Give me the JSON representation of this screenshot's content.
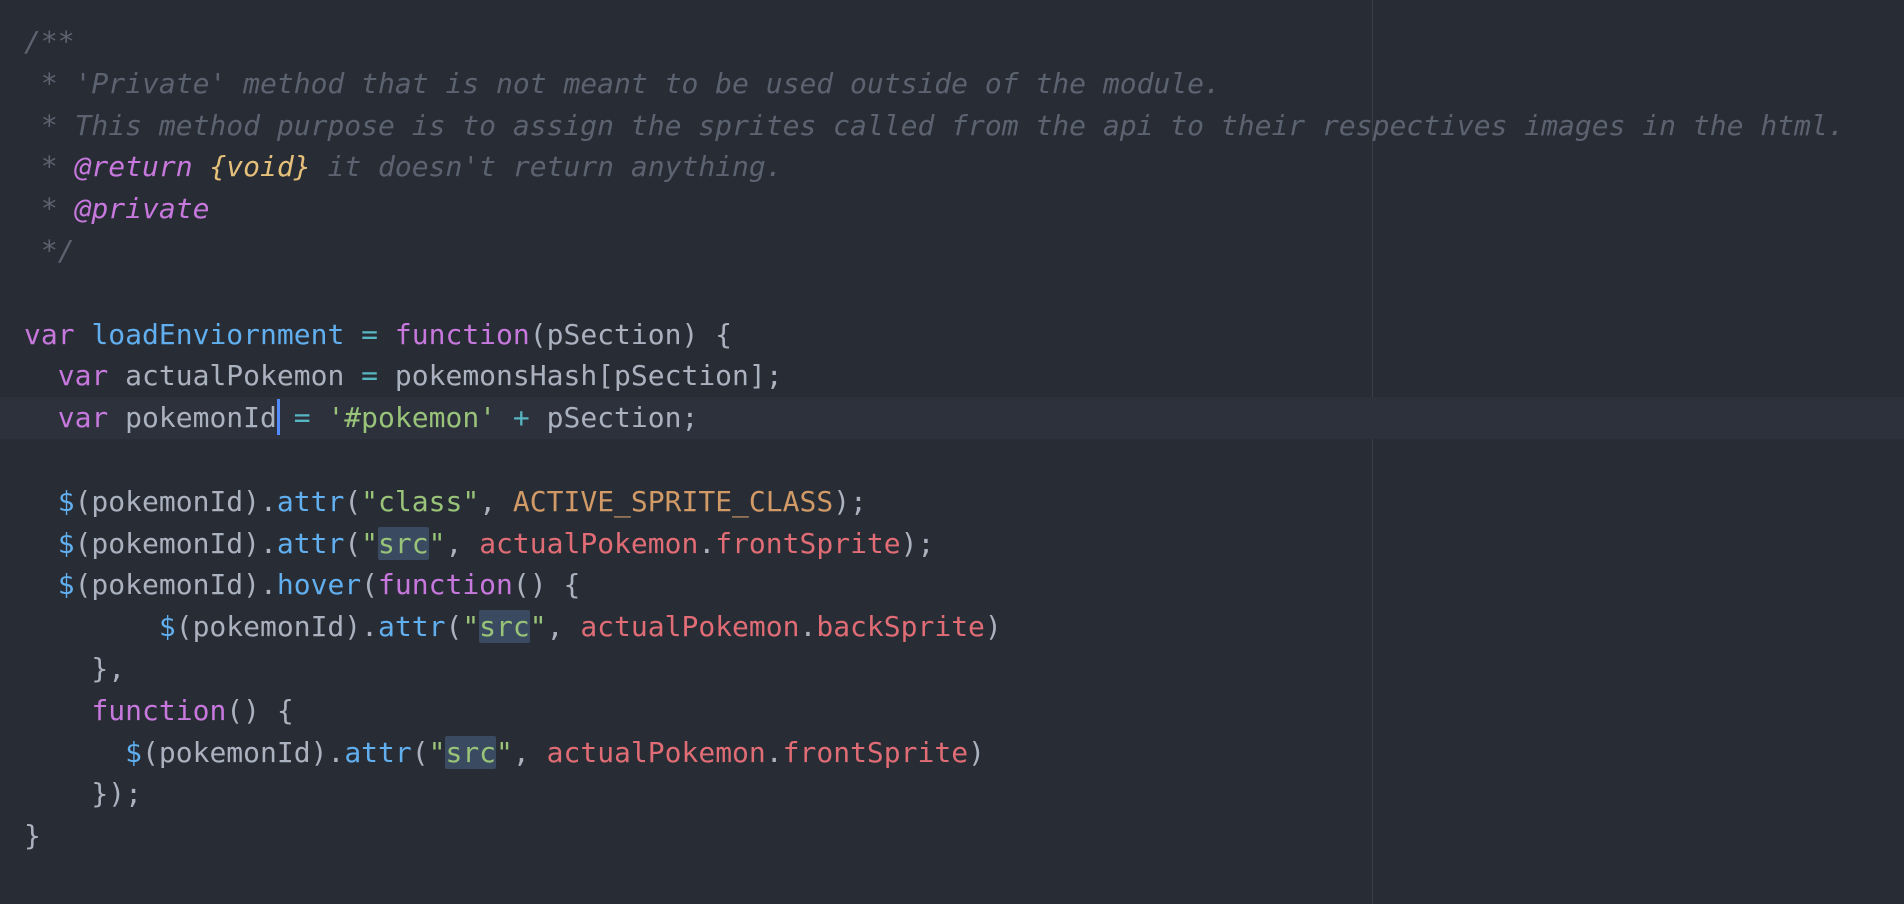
{
  "editor": {
    "theme_colors": {
      "background": "#282c34",
      "current_line": "#2c313c",
      "cursor": "#528bff",
      "comment": "#5c6370",
      "keyword": "#c678dd",
      "function": "#61afef",
      "operator": "#56b6c2",
      "string": "#98c379",
      "constant": "#d19a66",
      "property": "#e06c75",
      "text": "#abb2bf"
    },
    "cursor_line": 9,
    "lines": [
      [
        [
          "comment",
          "/**"
        ]
      ],
      [
        [
          "comment",
          " * 'Private' method that is not meant to be used outside of the module."
        ]
      ],
      [
        [
          "comment",
          " * This method purpose is to assign the sprites called from the api to their respectives images in the html."
        ]
      ],
      [
        [
          "comment",
          " * "
        ],
        [
          "tag",
          "@return"
        ],
        [
          "comment",
          " "
        ],
        [
          "type",
          "{void}"
        ],
        [
          "comment",
          " it doesn't return anything."
        ]
      ],
      [
        [
          "comment",
          " * "
        ],
        [
          "tag",
          "@private"
        ]
      ],
      [
        [
          "comment",
          " */"
        ]
      ],
      [],
      [
        [
          "kw",
          "var"
        ],
        [
          "text",
          " "
        ],
        [
          "fn",
          "loadEnviornment"
        ],
        [
          "text",
          " "
        ],
        [
          "op",
          "="
        ],
        [
          "text",
          " "
        ],
        [
          "kw",
          "function"
        ],
        [
          "text",
          "(pSection) {"
        ]
      ],
      [
        [
          "text",
          "  "
        ],
        [
          "kw",
          "var"
        ],
        [
          "text",
          " actualPokemon "
        ],
        [
          "op",
          "="
        ],
        [
          "text",
          " pokemonsHash[pSection];"
        ]
      ],
      [
        [
          "text",
          "  "
        ],
        [
          "kw",
          "var"
        ],
        [
          "text",
          " pokemonId"
        ],
        [
          "cursor",
          ""
        ],
        [
          "text",
          " "
        ],
        [
          "op",
          "="
        ],
        [
          "text",
          " "
        ],
        [
          "str",
          "'#pokemon'"
        ],
        [
          "text",
          " "
        ],
        [
          "op",
          "+"
        ],
        [
          "text",
          " pSection;"
        ]
      ],
      [],
      [
        [
          "text",
          "  "
        ],
        [
          "fn",
          "$"
        ],
        [
          "text",
          "(pokemonId)."
        ],
        [
          "fn",
          "attr"
        ],
        [
          "text",
          "("
        ],
        [
          "str",
          "\"class\""
        ],
        [
          "text",
          ", "
        ],
        [
          "const",
          "ACTIVE_SPRITE_CLASS"
        ],
        [
          "text",
          ");"
        ]
      ],
      [
        [
          "text",
          "  "
        ],
        [
          "fn",
          "$"
        ],
        [
          "text",
          "(pokemonId)."
        ],
        [
          "fn",
          "attr"
        ],
        [
          "text",
          "("
        ],
        [
          "str",
          "\""
        ],
        [
          "strhl",
          "src"
        ],
        [
          "str",
          "\""
        ],
        [
          "text",
          ", "
        ],
        [
          "prop",
          "actualPokemon"
        ],
        [
          "text",
          "."
        ],
        [
          "prop",
          "frontSprite"
        ],
        [
          "text",
          ");"
        ]
      ],
      [
        [
          "text",
          "  "
        ],
        [
          "fn",
          "$"
        ],
        [
          "text",
          "(pokemonId)."
        ],
        [
          "fn",
          "hover"
        ],
        [
          "text",
          "("
        ],
        [
          "kw",
          "function"
        ],
        [
          "text",
          "() {"
        ]
      ],
      [
        [
          "text",
          "        "
        ],
        [
          "fn",
          "$"
        ],
        [
          "text",
          "(pokemonId)."
        ],
        [
          "fn",
          "attr"
        ],
        [
          "text",
          "("
        ],
        [
          "str",
          "\""
        ],
        [
          "strhl",
          "src"
        ],
        [
          "str",
          "\""
        ],
        [
          "text",
          ", "
        ],
        [
          "prop",
          "actualPokemon"
        ],
        [
          "text",
          "."
        ],
        [
          "prop",
          "backSprite"
        ],
        [
          "text",
          ")"
        ]
      ],
      [
        [
          "text",
          "    },"
        ]
      ],
      [
        [
          "text",
          "    "
        ],
        [
          "kw",
          "function"
        ],
        [
          "text",
          "() {"
        ]
      ],
      [
        [
          "text",
          "      "
        ],
        [
          "fn",
          "$"
        ],
        [
          "text",
          "(pokemonId)."
        ],
        [
          "fn",
          "attr"
        ],
        [
          "text",
          "("
        ],
        [
          "str",
          "\""
        ],
        [
          "strhl",
          "src"
        ],
        [
          "str",
          "\""
        ],
        [
          "text",
          ", "
        ],
        [
          "prop",
          "actualPokemon"
        ],
        [
          "text",
          "."
        ],
        [
          "prop",
          "frontSprite"
        ],
        [
          "text",
          ")"
        ]
      ],
      [
        [
          "text",
          "    });"
        ]
      ],
      [
        [
          "text",
          "}"
        ]
      ]
    ]
  }
}
